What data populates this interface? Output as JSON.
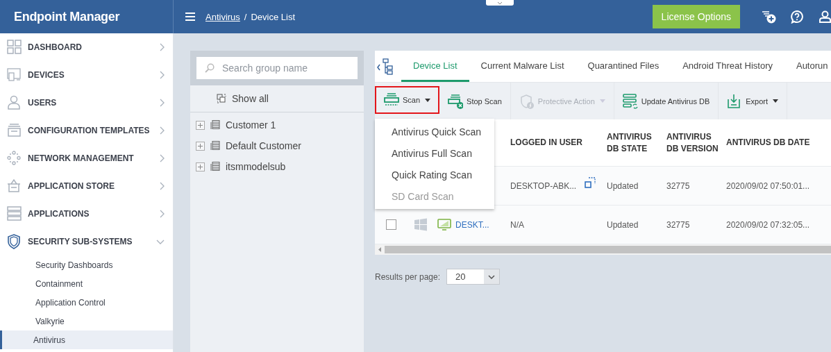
{
  "header": {
    "brand": "Endpoint Manager",
    "breadcrumb": [
      {
        "label": "Antivirus",
        "link": true
      },
      {
        "label": "Device List",
        "link": false
      }
    ],
    "separator": "/",
    "license_button": "License Options"
  },
  "sidebar": {
    "items": [
      {
        "label": "DASHBOARD",
        "expanded": false
      },
      {
        "label": "DEVICES",
        "expanded": false
      },
      {
        "label": "USERS",
        "expanded": false
      },
      {
        "label": "CONFIGURATION TEMPLATES",
        "expanded": false
      },
      {
        "label": "NETWORK MANAGEMENT",
        "expanded": false
      },
      {
        "label": "APPLICATION STORE",
        "expanded": false
      },
      {
        "label": "APPLICATIONS",
        "expanded": false
      },
      {
        "label": "SECURITY SUB-SYSTEMS",
        "expanded": true,
        "children": [
          {
            "label": "Security Dashboards",
            "selected": false
          },
          {
            "label": "Containment",
            "selected": false
          },
          {
            "label": "Application Control",
            "selected": false
          },
          {
            "label": "Valkyrie",
            "selected": false
          },
          {
            "label": "Antivirus",
            "selected": true
          }
        ]
      }
    ]
  },
  "groups": {
    "search": {
      "placeholder": "Search group name"
    },
    "show_all": "Show all",
    "items": [
      {
        "label": "Customer 1",
        "expanded": false
      },
      {
        "label": "Default Customer",
        "expanded": false
      },
      {
        "label": "itsmmodelsub",
        "expanded": false
      }
    ]
  },
  "tabs": [
    {
      "label": "Device List",
      "selected": true
    },
    {
      "label": "Current Malware List",
      "selected": false
    },
    {
      "label": "Quarantined Files",
      "selected": false
    },
    {
      "label": "Android Threat History",
      "selected": false
    },
    {
      "label": "Autorun",
      "selected": false
    }
  ],
  "toolbar": [
    {
      "label": "Scan",
      "dropdown": true,
      "disabled": false,
      "outlined": true
    },
    {
      "label": "Stop Scan",
      "dropdown": false,
      "disabled": false,
      "outlined": false
    },
    {
      "label": "Protective Action",
      "dropdown": true,
      "disabled": true,
      "outlined": false
    },
    {
      "label": "Update Antivirus DB",
      "dropdown": false,
      "disabled": false,
      "outlined": false
    },
    {
      "label": "Export",
      "dropdown": true,
      "disabled": false,
      "outlined": false
    }
  ],
  "scan_menu": [
    {
      "label": "Antivirus Quick Scan",
      "disabled": false
    },
    {
      "label": "Antivirus Full Scan",
      "disabled": false
    },
    {
      "label": "Quick Rating Scan",
      "disabled": false
    },
    {
      "label": "SD Card Scan",
      "disabled": true
    }
  ],
  "table": {
    "columns": [
      "LOGGED IN USER",
      "ANTIVIRUS DB STATE",
      "ANTIVIRUS DB VERSION",
      "ANTIVIRUS DB DATE"
    ],
    "rows": [
      {
        "logged_in_user": "DESKTOP-ABK...",
        "remote": true,
        "db_state": "Updated",
        "db_version": "32775",
        "db_date": "2020/09/02 07:50:01..."
      },
      {
        "checked": false,
        "name": "DESKT...",
        "logged_in_user": "N/A",
        "remote": false,
        "db_state": "Updated",
        "db_version": "32775",
        "db_date": "2020/09/02 07:32:05..."
      }
    ]
  },
  "pagination": {
    "label": "Results per page:",
    "value": "20"
  }
}
